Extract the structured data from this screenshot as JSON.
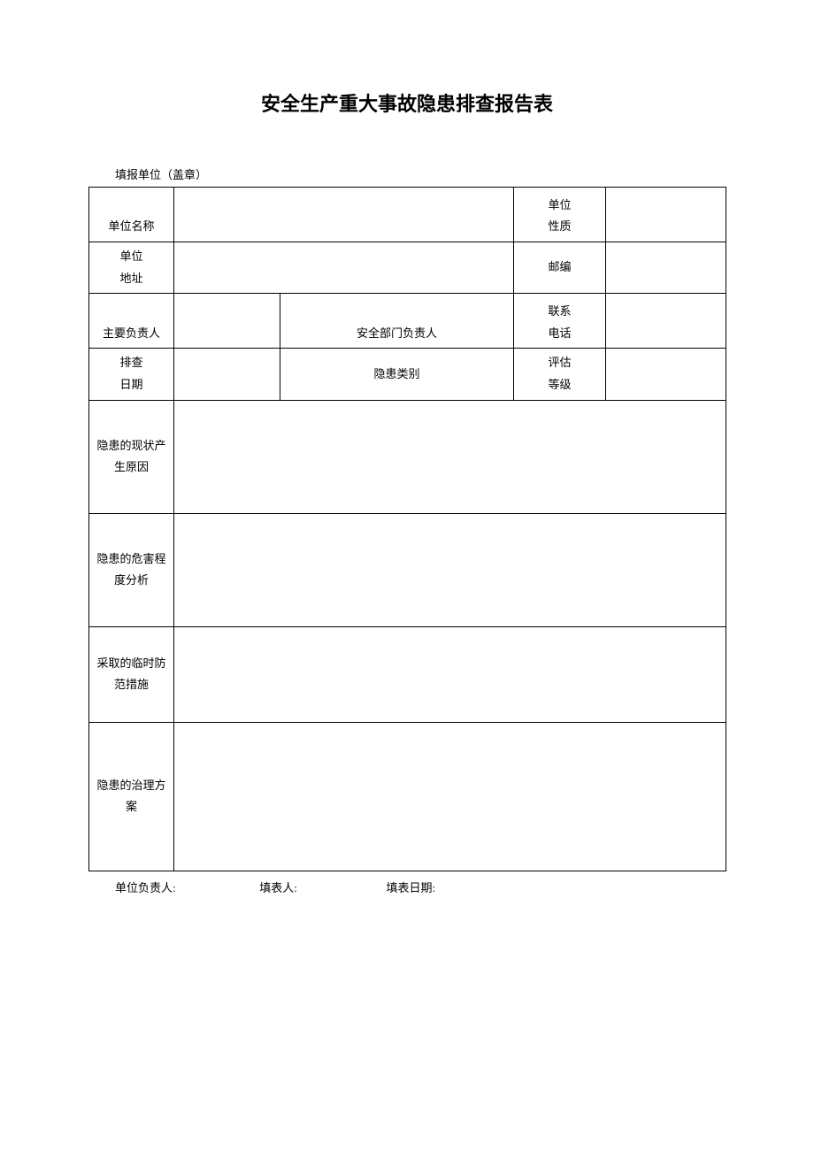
{
  "title": "安全生产重大事故隐患排查报告表",
  "header": "填报单位（盖章）",
  "labels": {
    "unit_name": "单位名称",
    "unit_nature": "单位\n性质",
    "unit_address_l1": "单位",
    "unit_address_l2": "地址",
    "postcode": "邮编",
    "main_person": "主要负责人",
    "safety_person": "安全部门负责人",
    "contact_l1": "联系",
    "contact_l2": "电话",
    "check_date_l1": "排查",
    "check_date_l2": "日期",
    "hazard_type": "隐患类别",
    "eval_level_l1": "评估",
    "eval_level_l2": "等级",
    "hazard_status_l1": "隐患的现状产",
    "hazard_status_l2": "生原因",
    "hazard_degree_l1": "隐患的危害程",
    "hazard_degree_l2": "度分析",
    "temp_measures_l1": "采取的临时防",
    "temp_measures_l2": "范措施",
    "treatment_l1": "隐患的治理方",
    "treatment_l2": "案"
  },
  "values": {
    "unit_name": "",
    "unit_nature": "",
    "unit_address": "",
    "postcode": "",
    "main_person": "",
    "safety_person": "",
    "contact_phone": "",
    "check_date": "",
    "hazard_type": "",
    "eval_level": "",
    "hazard_status": "",
    "hazard_degree": "",
    "temp_measures": "",
    "treatment": ""
  },
  "footer": {
    "unit_leader": "单位负责人:",
    "preparer": "填表人:",
    "fill_date": "填表日期:"
  }
}
